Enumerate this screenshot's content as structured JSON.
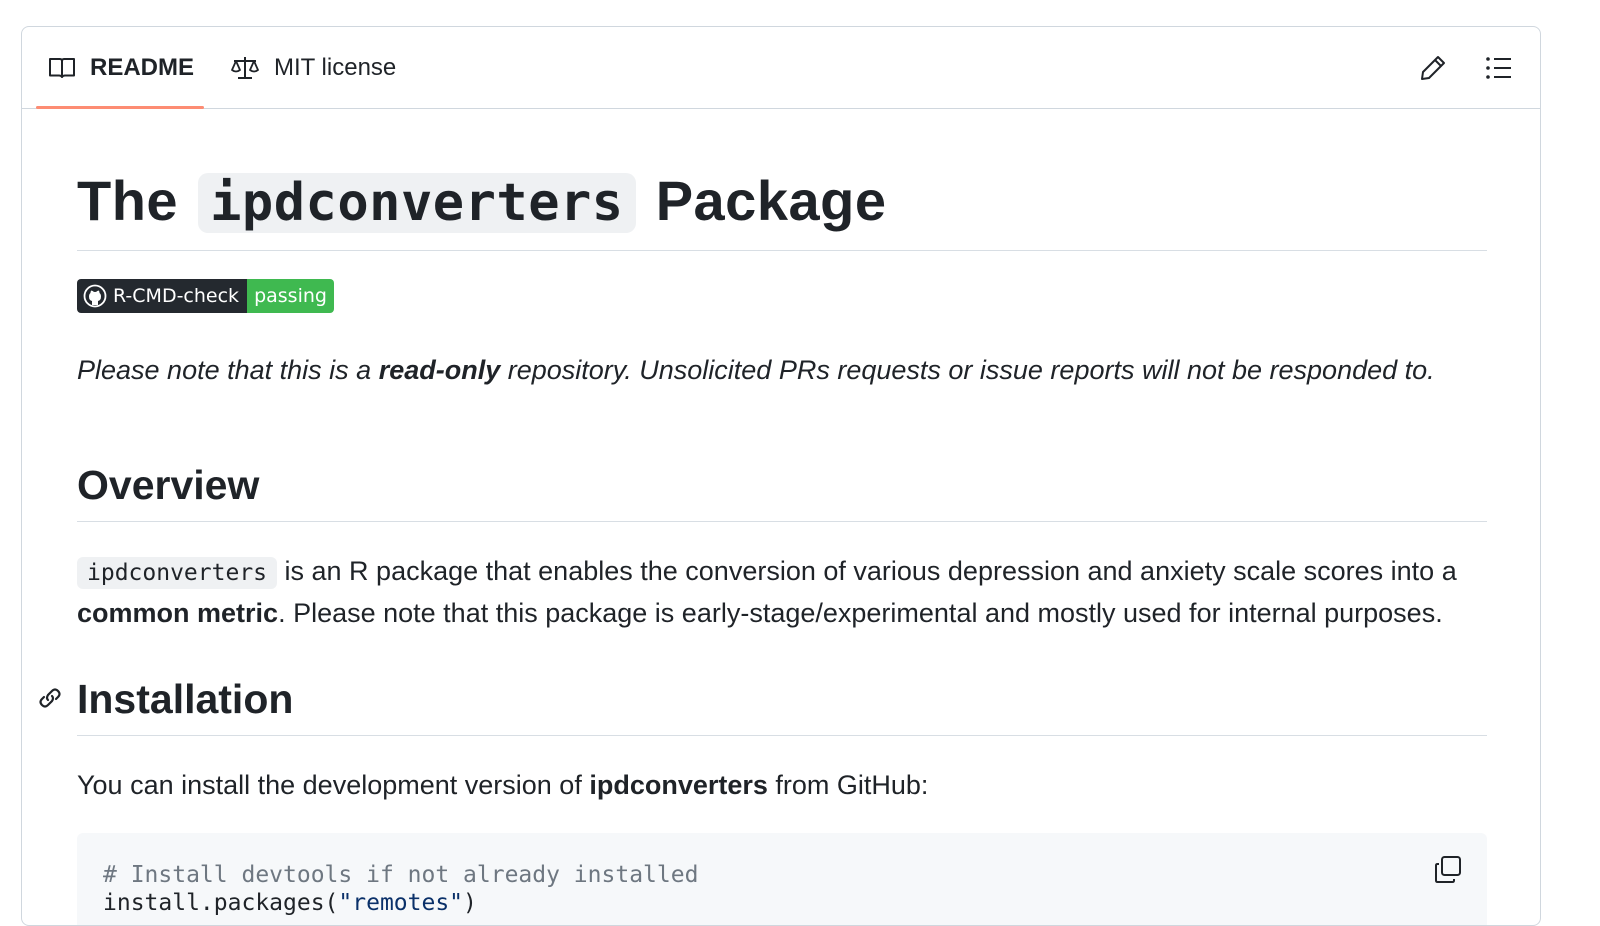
{
  "tabs": {
    "readme_label": "README",
    "license_label": "MIT license",
    "active": "README"
  },
  "icons": {
    "readme": "book-icon",
    "license": "law-scale-icon",
    "edit": "pencil-icon",
    "outline": "list-unordered-icon",
    "anchor": "link-icon",
    "copy": "copy-icon",
    "badge_logo": "github-icon"
  },
  "title": {
    "prefix": "The",
    "code": "ipdconverters",
    "suffix": "Package"
  },
  "badge": {
    "label": "R-CMD-check",
    "status": "passing",
    "label_color": "#24292f",
    "status_color": "#3fb950"
  },
  "note": {
    "before": "Please note that this is a ",
    "bold": "read-only",
    "after": " repository. Unsolicited PRs requests or issue reports will not be responded to."
  },
  "overview": {
    "heading": "Overview",
    "code": "ipdconverters",
    "text1": " is an R package that enables the conversion of various depression and anxiety scale scores into a ",
    "bold": "common metric",
    "text2": ". Please note that this package is early-stage/experimental and mostly used for internal purposes."
  },
  "installation": {
    "heading": "Installation",
    "text1": "You can install the development version of ",
    "bold": "ipdconverters",
    "text2": " from GitHub:",
    "code_line1": "# Install devtools if not already installed",
    "code_line2_func": "install.packages(",
    "code_line2_str": "\"remotes\"",
    "code_line2_end": ")"
  },
  "colors": {
    "accent_underline": "#fd8c73",
    "border": "#d0d7de",
    "code_bg": "#f6f8fa"
  }
}
